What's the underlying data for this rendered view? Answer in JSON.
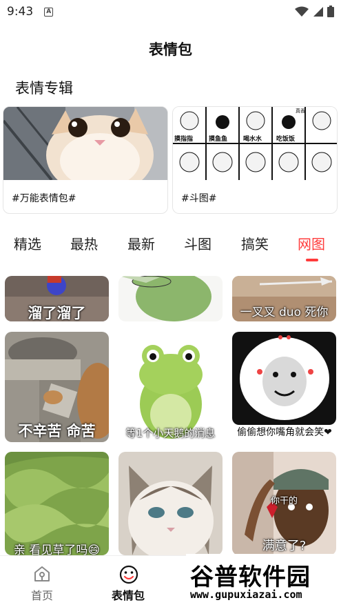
{
  "status_bar": {
    "time": "9:43",
    "notification_icon": "a-box-icon",
    "icons": [
      "wifi-icon",
      "signal-icon",
      "battery-icon"
    ]
  },
  "header": {
    "title": "表情包"
  },
  "albums": {
    "section_title": "表情专辑",
    "items": [
      {
        "label": "#万能表情包#"
      },
      {
        "label": "#斗图#",
        "sticker_texts": [
          "真香",
          "摸鱼鱼",
          "喝水水",
          "吃饭饭",
          "摸指指"
        ]
      }
    ]
  },
  "tabs": {
    "items": [
      "精选",
      "最热",
      "最新",
      "斗图",
      "搞笑",
      "网图"
    ],
    "active": "网图"
  },
  "memes": [
    {
      "caption": "溜了溜了"
    },
    {
      "caption": ""
    },
    {
      "caption": "一叉叉 duo 死你"
    },
    {
      "caption": "不辛苦 命苦"
    },
    {
      "caption": "等1个小天鹅的消息"
    },
    {
      "caption": "偷偷想你嘴角就会笑❤"
    },
    {
      "caption": "亲 看见草了吗😄"
    },
    {
      "caption": ""
    },
    {
      "caption": "满意了?",
      "sub_caption": "你干的"
    }
  ],
  "bottom_nav": {
    "items": [
      {
        "label": "首页",
        "icon": "home-icon",
        "active": false
      },
      {
        "label": "表情包",
        "icon": "smiley-icon",
        "active": true
      }
    ]
  },
  "watermark": {
    "text": "谷普软件园",
    "url": "www.gupuxiazai.com"
  },
  "colors": {
    "accent": "#ff3b3b",
    "text": "#111111",
    "inactive": "#666666"
  }
}
